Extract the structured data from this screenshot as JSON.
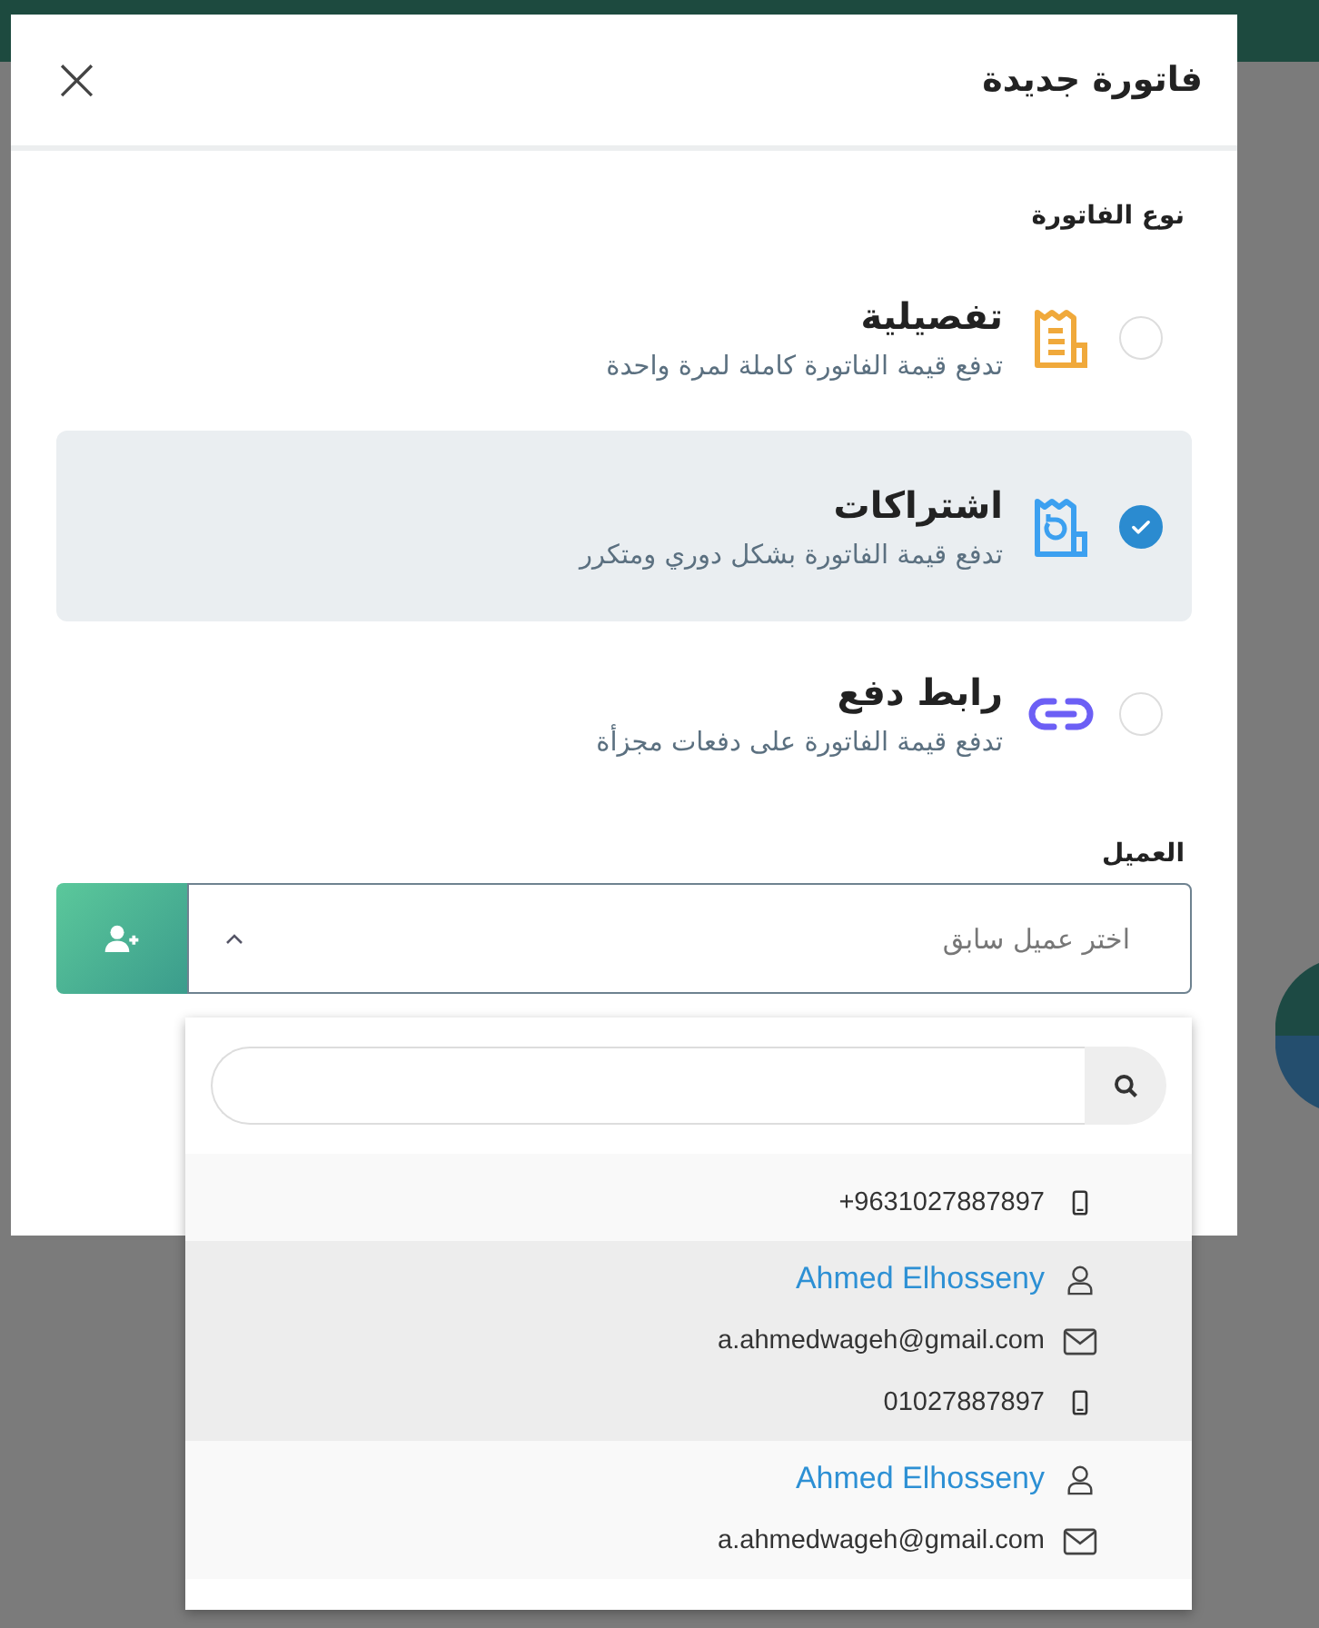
{
  "dialog": {
    "title": "فاتورة جديدة",
    "close": "×"
  },
  "invoice_type": {
    "label": "نوع الفاتورة",
    "options": [
      {
        "kind": "detailed",
        "title": "تفصيلية",
        "description": "تدفع قيمة الفاتورة كاملة لمرة واحدة",
        "selected": false
      },
      {
        "kind": "subscription",
        "title": "اشتراكات",
        "description": "تدفع قيمة الفاتورة بشكل دوري ومتكرر",
        "selected": true
      },
      {
        "kind": "link",
        "title": "رابط دفع",
        "description": "تدفع قيمة الفاتورة على دفعات مجزأة",
        "selected": false
      }
    ]
  },
  "client": {
    "label": "العميل",
    "placeholder": "اختر عميل سابق",
    "expanded": true
  },
  "dropdown": {
    "clients": [
      {
        "phone": "+9631027887897",
        "selected": false
      },
      {
        "name": "Ahmed Elhosseny",
        "email": "a.ahmedwageh@gmail.com",
        "phone": "01027887897",
        "selected": true
      },
      {
        "name": "Ahmed Elhosseny",
        "email": "a.ahmedwageh@gmail.com",
        "selected": false
      }
    ]
  }
}
